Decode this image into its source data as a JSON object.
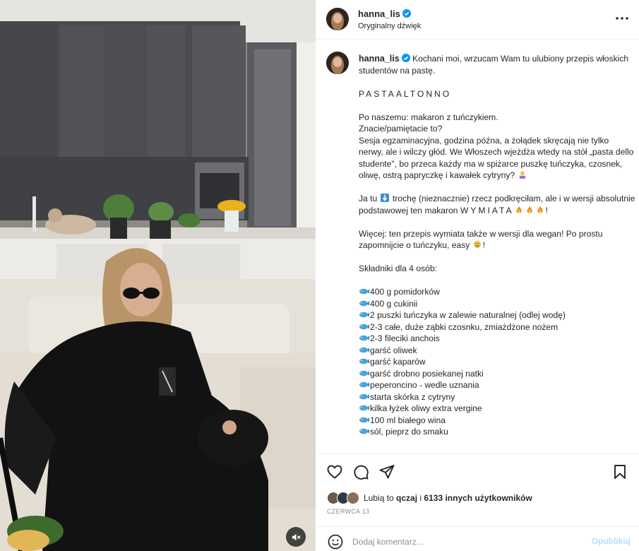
{
  "post": {
    "username": "hanna_lis",
    "audio_label": "Oryginalny dźwięk",
    "verified": true
  },
  "icons": {
    "more": "more-horizontal-icon",
    "verified": "verified-badge-icon",
    "mute": "speaker-muted-icon",
    "like": "heart-icon",
    "comment": "comment-bubble-icon",
    "share": "paper-plane-icon",
    "save": "bookmark-icon",
    "emoji": "smiley-icon",
    "ingredient_bullet": "fish-icon"
  },
  "caption": {
    "username": "hanna_lis",
    "intro": "Kochani moi, wrzucam Wam tu ulubiony przepis włoskich studentów na pastę.",
    "title": "PASTAALTONNO",
    "p1_l1": "Po naszemu: makaron z tuńczykiem.",
    "p1_l2": "Znacie/pamiętacie to?",
    "p1_l3": "Sesja egzaminacyjna, godzina późna, a żołądek skręcają nie tylko nerwy, ale i wilczy głód. We Włoszech wjeżdża wtedy na stół „pasta dello studente\", bo przeca każdy ma w spiżarce puszkę tuńczyka, czosnek, oliwę, ostrą papryczkę i kawałek cytryny?",
    "p2_a": "Ja tu",
    "p2_b": "trochę (nieznacznie) rzecz podkręciłam, ale i w wersji absolutnie podstawowej ten makaron",
    "p2_c": "WYMIATA",
    "p3_a": "Więcej: ten przepis wymiata także w wersji dla wegan! Po prostu zapomnijcie o tuńczyku, easy",
    "p3_b": "!",
    "ingredients_header": "Składniki dla 4 osób:",
    "ingredients": [
      "400 g pomidorków",
      "400 g cukinii",
      "2 puszki tuńczyka w zalewie naturalnej (odlej wodę)",
      "2-3 całe, duże ząbki czosnku, zmiażdżone nożem",
      "2-3 fileciki anchois",
      "garść oliwek",
      "garść kaparów",
      "garść drobno posiekanej natki",
      "peperoncino - wedle uznania",
      "starta skórka z cytryny",
      "kilka łyżek oliwy extra vergine",
      "100 ml białego wina",
      "sól, pieprz do smaku"
    ]
  },
  "likes": {
    "prefix": "Lubią to",
    "user": "qczaj",
    "middle": "i",
    "count_text": "6133 innych użytkowników"
  },
  "date": "CZERWCA 13",
  "comment": {
    "placeholder": "Dodaj komentarz...",
    "publish": "Opublikuj"
  }
}
